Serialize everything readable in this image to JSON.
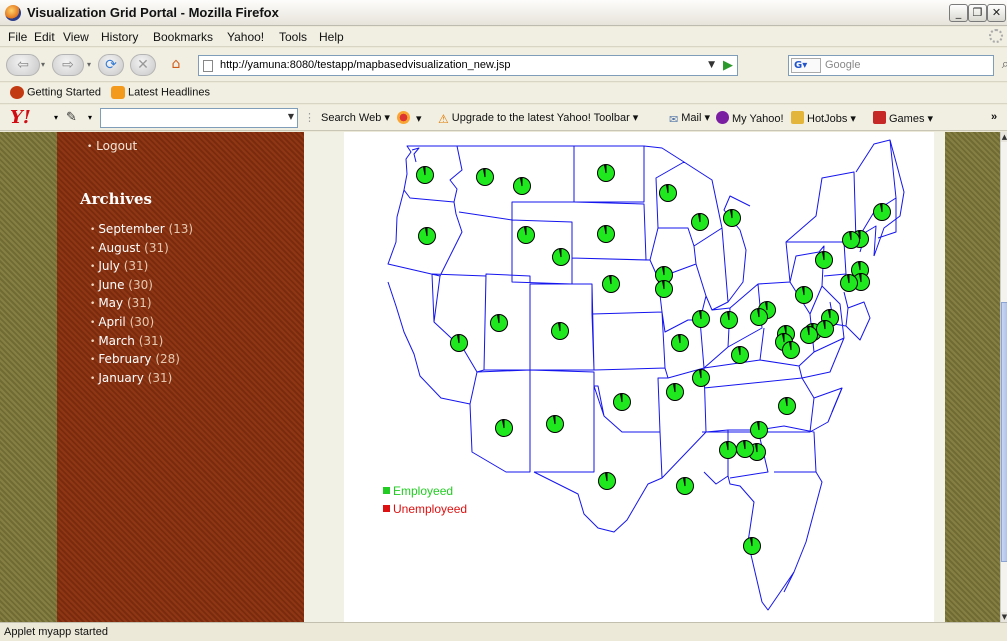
{
  "window": {
    "title": "Visualization Grid Portal - Mozilla Firefox"
  },
  "menu": [
    "File",
    "Edit",
    "View",
    "History",
    "Bookmarks",
    "Yahoo!",
    "Tools",
    "Help"
  ],
  "nav": {
    "url": "http://yamuna:8080/testapp/mapbasedvisualization_new.jsp",
    "search_placeholder": "Google",
    "search_engine": "G"
  },
  "bookmarks": [
    "Getting Started",
    "Latest Headlines"
  ],
  "yahoo_toolbar": {
    "logo": "Y!",
    "items": [
      "Search Web",
      "Upgrade to the latest Yahoo! Toolbar",
      "Mail",
      "My Yahoo!",
      "HotJobs",
      "Games"
    ]
  },
  "sidebar": {
    "logout": "Logout",
    "archives_title": "Archives",
    "archives": [
      {
        "month": "September",
        "count": "(13)"
      },
      {
        "month": "August",
        "count": "(31)"
      },
      {
        "month": "July",
        "count": "(31)"
      },
      {
        "month": "June",
        "count": "(30)"
      },
      {
        "month": "May",
        "count": "(31)"
      },
      {
        "month": "April",
        "count": "(30)"
      },
      {
        "month": "March",
        "count": "(31)"
      },
      {
        "month": "February",
        "count": "(28)"
      },
      {
        "month": "January",
        "count": "(31)"
      }
    ]
  },
  "map": {
    "legend": [
      {
        "label": "Employeed",
        "color": "#22cc22"
      },
      {
        "label": "Unemployeed",
        "color": "#dd1111"
      }
    ],
    "marker_count": 49
  },
  "status": {
    "text": "Applet myapp started"
  }
}
